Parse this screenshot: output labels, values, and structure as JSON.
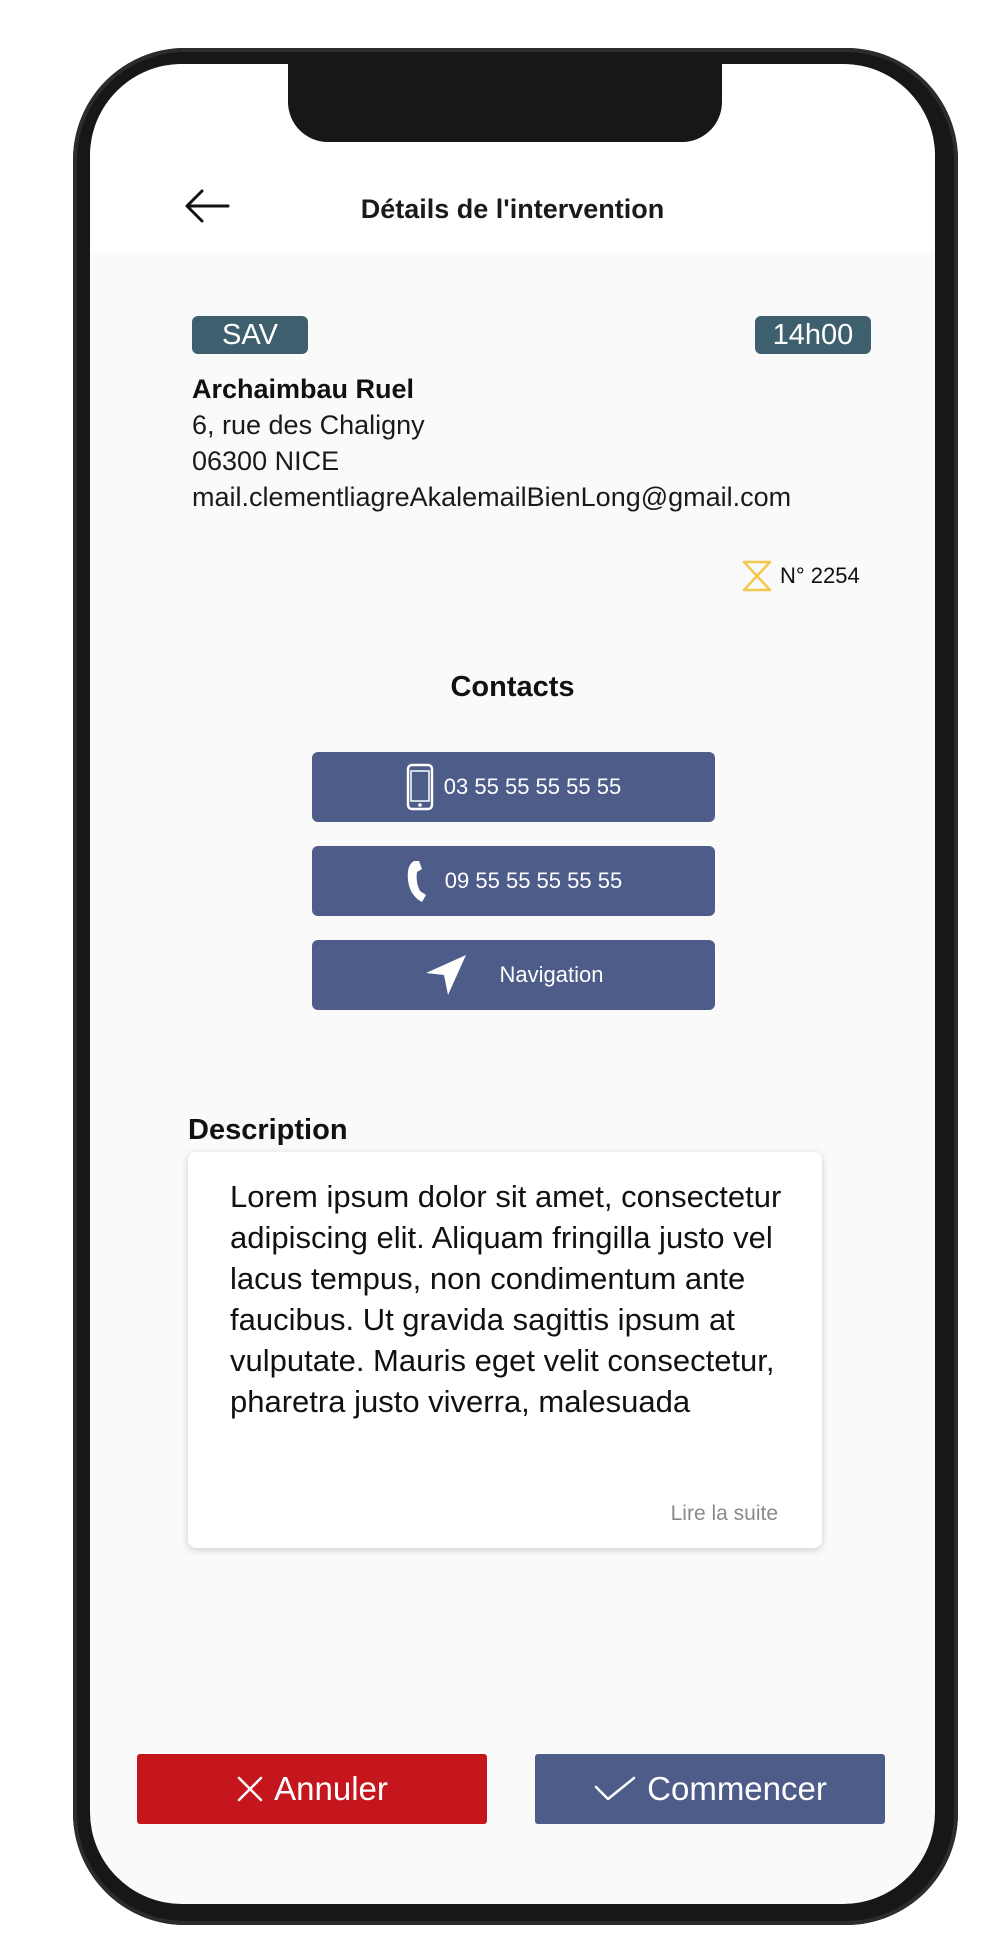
{
  "header": {
    "title": "Détails de l'intervention"
  },
  "intervention": {
    "type_badge": "SAV",
    "time_badge": "14h00",
    "client_name": "Archaimbau Ruel",
    "address_line1": "6, rue des Chaligny",
    "address_line2": "06300 NICE",
    "email": "mail.clementliagreAkalemailBienLong@gmail.com",
    "number": "N° 2254",
    "status_icon": "hourglass-icon"
  },
  "contacts": {
    "title": "Contacts",
    "mobile": {
      "label": "03 55 55 55 55 55",
      "icon": "smartphone-icon"
    },
    "phone": {
      "label": "09 55 55 55 55 55",
      "icon": "phone-icon"
    },
    "navigation": {
      "label": "Navigation",
      "icon": "navigation-arrow-icon"
    }
  },
  "description": {
    "title": "Description",
    "text": "Lorem ipsum dolor sit amet, consectetur adipiscing elit. Aliquam fringilla justo vel lacus tempus, non condimentum ante faucibus. Ut gravida sagittis ipsum at vulputate. Mauris eget velit consectetur, pharetra justo viverra, malesuada",
    "read_more": "Lire la suite"
  },
  "actions": {
    "cancel_label": "Annuler",
    "start_label": "Commencer"
  },
  "colors": {
    "badge": "#3e5f6d",
    "primary": "#4d5c88",
    "danger": "#c4161c",
    "hourglass": "#f2c94c"
  }
}
